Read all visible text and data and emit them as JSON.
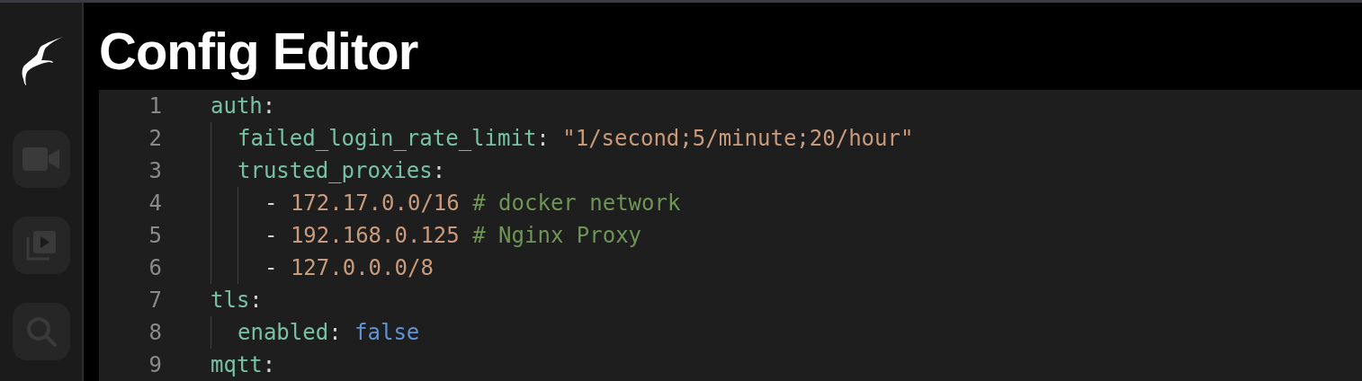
{
  "sidebar": {
    "items": [
      {
        "kind": "camera",
        "selected": false
      },
      {
        "kind": "library",
        "selected": false
      },
      {
        "kind": "search",
        "selected": false
      }
    ]
  },
  "title": "Config Editor",
  "editor": {
    "lines": [
      {
        "number": "1",
        "tokens": [
          {
            "kind": "key",
            "text": "auth"
          },
          {
            "kind": "punct",
            "text": ":"
          }
        ],
        "children": [
          {
            "number": "2",
            "tokens": [
              {
                "kind": "key",
                "text": "failed_login_rate_limit"
              },
              {
                "kind": "punct",
                "text": ": "
              },
              {
                "kind": "string",
                "text": "\"1/second;5/minute;20/hour\""
              }
            ]
          },
          {
            "number": "3",
            "tokens": [
              {
                "kind": "key",
                "text": "trusted_proxies"
              },
              {
                "kind": "punct",
                "text": ":"
              }
            ],
            "children": [
              {
                "number": "4",
                "tokens": [
                  {
                    "kind": "punct",
                    "text": "- "
                  },
                  {
                    "kind": "string",
                    "text": "172.17.0.0/16"
                  },
                  {
                    "kind": "comment",
                    "text": " # docker network"
                  }
                ]
              },
              {
                "number": "5",
                "tokens": [
                  {
                    "kind": "punct",
                    "text": "- "
                  },
                  {
                    "kind": "string",
                    "text": "192.168.0.125"
                  },
                  {
                    "kind": "comment",
                    "text": " # Nginx Proxy"
                  }
                ]
              },
              {
                "number": "6",
                "tokens": [
                  {
                    "kind": "punct",
                    "text": "- "
                  },
                  {
                    "kind": "string",
                    "text": "127.0.0.0/8"
                  }
                ]
              }
            ]
          }
        ]
      },
      {
        "number": "7",
        "tokens": [
          {
            "kind": "key",
            "text": "tls"
          },
          {
            "kind": "punct",
            "text": ":"
          }
        ],
        "children": [
          {
            "number": "8",
            "tokens": [
              {
                "kind": "key",
                "text": "enabled"
              },
              {
                "kind": "punct",
                "text": ": "
              },
              {
                "kind": "bool",
                "text": "false"
              }
            ]
          }
        ]
      },
      {
        "number": "9",
        "tokens": [
          {
            "kind": "key",
            "text": "mqtt"
          },
          {
            "kind": "punct",
            "text": ":"
          }
        ]
      }
    ]
  }
}
